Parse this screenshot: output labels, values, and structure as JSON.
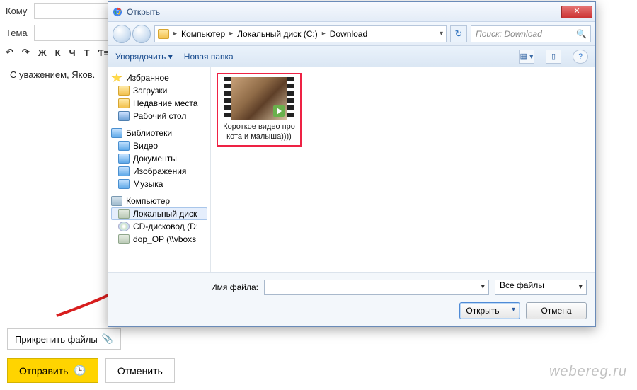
{
  "email": {
    "to_label": "Кому",
    "subject_label": "Тема",
    "body": "С уважением, Яков.",
    "attach_label": "Прикрепить файлы",
    "send_label": "Отправить",
    "cancel_label": "Отменить",
    "toolbar": {
      "bold": "Ж",
      "italic": "К",
      "underline": "Ч",
      "strike": "Т"
    }
  },
  "dialog": {
    "title": "Открыть",
    "breadcrumbs": [
      "Компьютер",
      "Локальный диск (C:)",
      "Download"
    ],
    "search_placeholder": "Поиск: Download",
    "organize": "Упорядочить",
    "new_folder": "Новая папка",
    "favorites_header": "Избранное",
    "favorites": [
      "Загрузки",
      "Недавние места",
      "Рабочий стол"
    ],
    "libraries_header": "Библиотеки",
    "libraries": [
      "Видео",
      "Документы",
      "Изображения",
      "Музыка"
    ],
    "computer_header": "Компьютер",
    "computer": [
      "Локальный диск",
      "CD-дисковод (D:",
      "dop_OP (\\\\vboxs"
    ],
    "file_name": "Короткое видео про кота и малыша))))",
    "filename_label": "Имя файла:",
    "file_type": "Все файлы",
    "open_btn": "Открыть",
    "cancel_btn": "Отмена"
  },
  "watermark": "webereg.ru"
}
